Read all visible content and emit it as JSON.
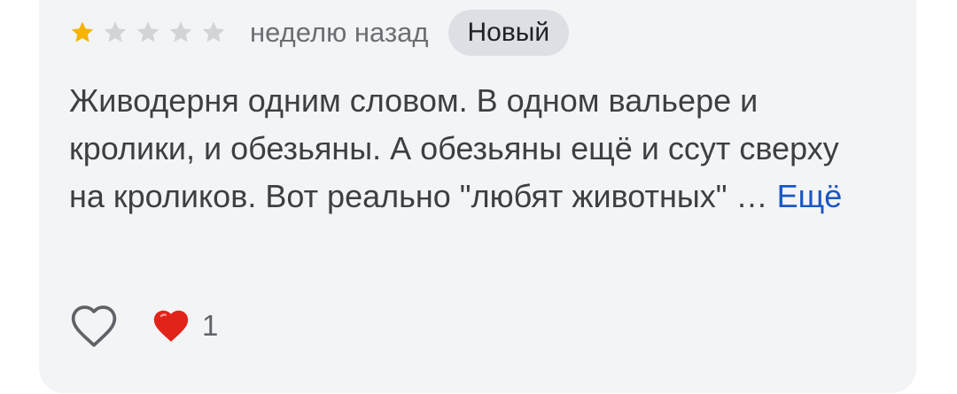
{
  "review": {
    "rating": 1,
    "max_rating": 5,
    "time": "неделю назад",
    "badge": "Новый",
    "text": "Живодерня одним словом. В одном вальере и кролики, и обезьяны. А обезьяны ещё и ссут сверху на кроликов. Вот реально \"любят животных\" …",
    "more_label": "Ещё"
  },
  "reactions": {
    "count": "1"
  },
  "colors": {
    "star_filled": "#f4b400",
    "star_empty": "#d2d4d7",
    "link": "#1a56c4",
    "heart": "#e2231a"
  },
  "icons": {
    "like": "heart-outline-icon",
    "reaction": "red-heart-icon"
  }
}
